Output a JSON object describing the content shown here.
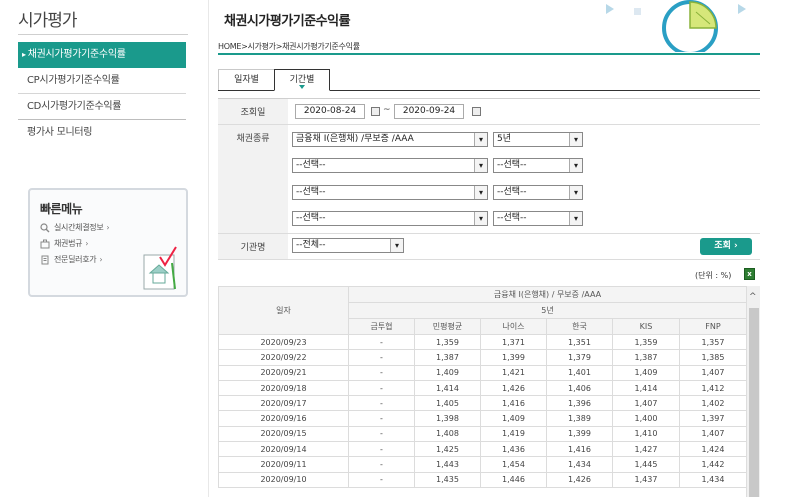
{
  "left": {
    "title": "시가평가",
    "nav": [
      {
        "label": "채권시가평가기준수익률",
        "active": true
      },
      {
        "label": "CP시가평가기준수익률",
        "active": false
      },
      {
        "label": "CD시가평가기준수익률",
        "active": false
      },
      {
        "label": "평가사 모니터링",
        "active": false
      }
    ],
    "quick_menu": {
      "title": "빠른메뉴",
      "items": [
        {
          "label": "실시간체결정보",
          "icon": "search-icon"
        },
        {
          "label": "채권법규",
          "icon": "briefcase-icon"
        },
        {
          "label": "전문딜러호가",
          "icon": "document-icon"
        }
      ]
    }
  },
  "main": {
    "title": "채권시가평가기준수익률",
    "breadcrumb": "HOME>시가평가>채권시가평가기준수익률",
    "tabs": [
      {
        "label": "일자별",
        "active": false
      },
      {
        "label": "기간별",
        "active": true
      }
    ],
    "form": {
      "date_label": "조회일",
      "date_from": "2020-08-24",
      "date_sep": "~",
      "date_to": "2020-09-24",
      "bond_label": "채권종류",
      "bond_rows": [
        {
          "type": "금융채 I(은행채) /무보증 /AAA",
          "term": "5년"
        },
        {
          "type": "--선택--",
          "term": "--선택--"
        },
        {
          "type": "--선택--",
          "term": "--선택--"
        },
        {
          "type": "--선택--",
          "term": "--선택--"
        }
      ],
      "org_label": "기관명",
      "org_value": "--전체--",
      "search_button": "조회 ›"
    },
    "unit": "(단위 : %)",
    "table": {
      "date_header": "일자",
      "group_header": "금융채 I(은행채) / 무보증 /AAA",
      "term_header": "5년",
      "columns": [
        "금투협",
        "민평평균",
        "나이스",
        "한국",
        "KIS",
        "FNP"
      ],
      "rows": [
        [
          "2020/09/23",
          "-",
          "1,359",
          "1,371",
          "1,351",
          "1,359",
          "1,357"
        ],
        [
          "2020/09/22",
          "-",
          "1,387",
          "1,399",
          "1,379",
          "1,387",
          "1,385"
        ],
        [
          "2020/09/21",
          "-",
          "1,409",
          "1,421",
          "1,401",
          "1,409",
          "1,407"
        ],
        [
          "2020/09/18",
          "-",
          "1,414",
          "1,426",
          "1,406",
          "1,414",
          "1,412"
        ],
        [
          "2020/09/17",
          "-",
          "1,405",
          "1,416",
          "1,396",
          "1,407",
          "1,402"
        ],
        [
          "2020/09/16",
          "-",
          "1,398",
          "1,409",
          "1,389",
          "1,400",
          "1,397"
        ],
        [
          "2020/09/15",
          "-",
          "1,408",
          "1,419",
          "1,399",
          "1,410",
          "1,407"
        ],
        [
          "2020/09/14",
          "-",
          "1,425",
          "1,436",
          "1,416",
          "1,427",
          "1,424"
        ],
        [
          "2020/09/11",
          "-",
          "1,443",
          "1,454",
          "1,434",
          "1,445",
          "1,442"
        ],
        [
          "2020/09/10",
          "-",
          "1,435",
          "1,446",
          "1,426",
          "1,437",
          "1,434"
        ]
      ]
    }
  },
  "colors": {
    "accent": "#1a9a8c",
    "header_bg": "#f4f4f4"
  }
}
